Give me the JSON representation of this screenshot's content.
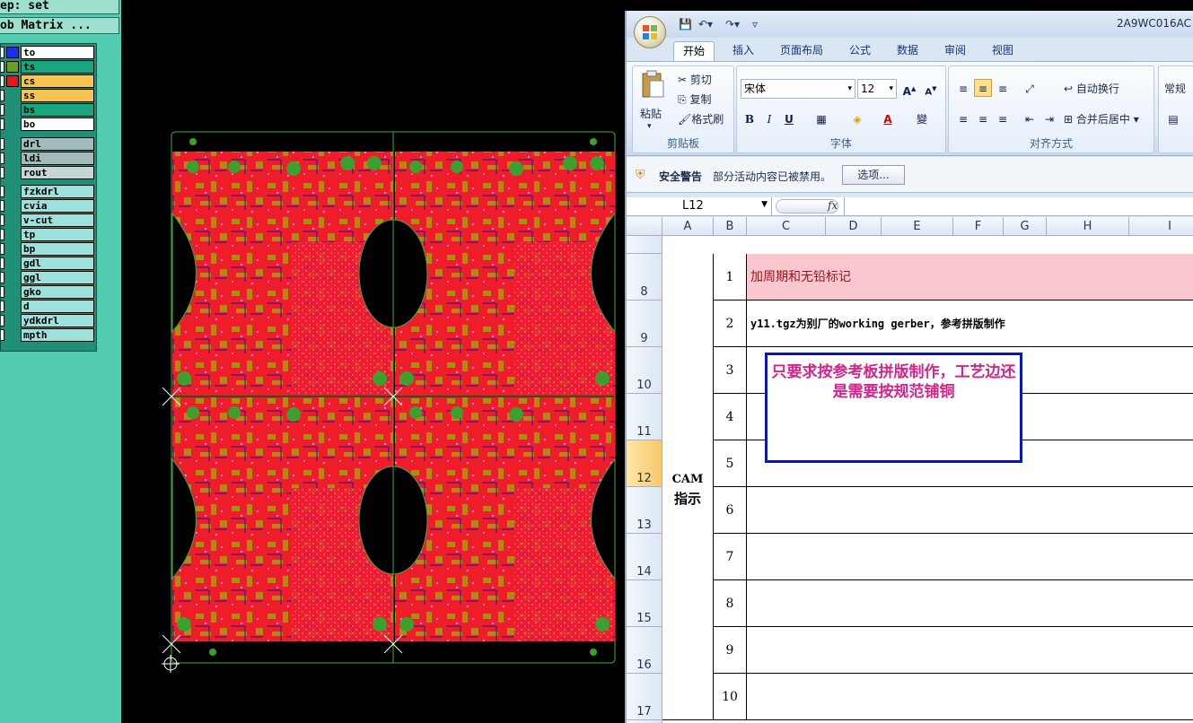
{
  "cam": {
    "step_label": "ep: set",
    "matrix_label": "ob Matrix ...",
    "layers": [
      {
        "name": "to",
        "color": "#1b2cf5",
        "bg": "#ffffff"
      },
      {
        "name": "ts",
        "color": "#6aa01d",
        "bg": "#17a67e"
      },
      {
        "name": "cs",
        "color": "#e4171c",
        "bg": "#f8c44e",
        "mark": "⊞"
      },
      {
        "name": "ss",
        "color": "",
        "bg": "#f8c44e"
      },
      {
        "name": "bs",
        "color": "",
        "bg": "#17a67e"
      },
      {
        "name": "bo",
        "color": "",
        "bg": "#ffffff"
      },
      {
        "name": "drl",
        "color": "",
        "bg": "#a3b9ba"
      },
      {
        "name": "ldi",
        "color": "",
        "bg": "#a3b9ba"
      },
      {
        "name": "rout",
        "color": "",
        "bg": "#c8d5d5"
      },
      {
        "name": "fzkdrl",
        "color": "",
        "bg": "#9ee0dc"
      },
      {
        "name": "cvia",
        "color": "",
        "bg": "#9ee0dc"
      },
      {
        "name": "v-cut",
        "color": "",
        "bg": "#9ee0dc"
      },
      {
        "name": "tp",
        "color": "",
        "bg": "#9ee0dc"
      },
      {
        "name": "bp",
        "color": "",
        "bg": "#9ee0dc"
      },
      {
        "name": "gdl",
        "color": "",
        "bg": "#9ee0dc"
      },
      {
        "name": "ggl",
        "color": "",
        "bg": "#9ee0dc"
      },
      {
        "name": "gko",
        "color": "",
        "bg": "#9ee0dc"
      },
      {
        "name": "d",
        "color": "",
        "bg": "#9ee0dc"
      },
      {
        "name": "ydkdrl",
        "color": "",
        "bg": "#9ee0dc"
      },
      {
        "name": "mpth",
        "color": "",
        "bg": "#9ee0dc"
      }
    ]
  },
  "excel": {
    "doc_title": "2A9WC016AC",
    "tabs": [
      "开始",
      "插入",
      "页面布局",
      "公式",
      "数据",
      "审阅",
      "视图"
    ],
    "clipboard": {
      "paste": "粘贴",
      "cut": "剪切",
      "copy": "复制",
      "format_painter": "格式刷",
      "group": "剪贴板"
    },
    "font": {
      "name": "宋体",
      "size": "12",
      "group": "字体",
      "bold": "B",
      "italic": "I",
      "underline": "U"
    },
    "alignment": {
      "wrap": "自动换行",
      "merge": "合并后居中",
      "group": "对齐方式"
    },
    "number": {
      "format": "常规"
    },
    "security": {
      "title": "安全警告",
      "message": "部分活动内容已被禁用。",
      "options": "选项..."
    },
    "name_box": "L12",
    "fx": "fx",
    "columns": [
      "A",
      "B",
      "C",
      "D",
      "E",
      "F",
      "G",
      "H",
      "I"
    ],
    "rows": [
      {
        "row": "8",
        "num": "1",
        "text": "加周期和无铅标记"
      },
      {
        "row": "9",
        "num": "2",
        "text": "y11.tgz为别厂的working gerber，参考拼版制作"
      },
      {
        "row": "10",
        "num": "3",
        "text": ""
      },
      {
        "row": "11",
        "num": "4",
        "text": ""
      },
      {
        "row": "12",
        "num": "5",
        "text": ""
      },
      {
        "row": "13",
        "num": "6",
        "text": ""
      },
      {
        "row": "14",
        "num": "7",
        "text": ""
      },
      {
        "row": "15",
        "num": "8",
        "text": ""
      },
      {
        "row": "16",
        "num": "9",
        "text": ""
      },
      {
        "row": "17",
        "num": "10",
        "text": ""
      }
    ],
    "cam_label_1": "CAM",
    "cam_label_2": "指示",
    "comment": "只要求按参考板拼版制作，工艺边还是需要按规范铺铜",
    "colors": {
      "highlight_row": "#fbc7cf",
      "comment_border": "#0b16b8",
      "comment_text": "#d8238a"
    }
  }
}
